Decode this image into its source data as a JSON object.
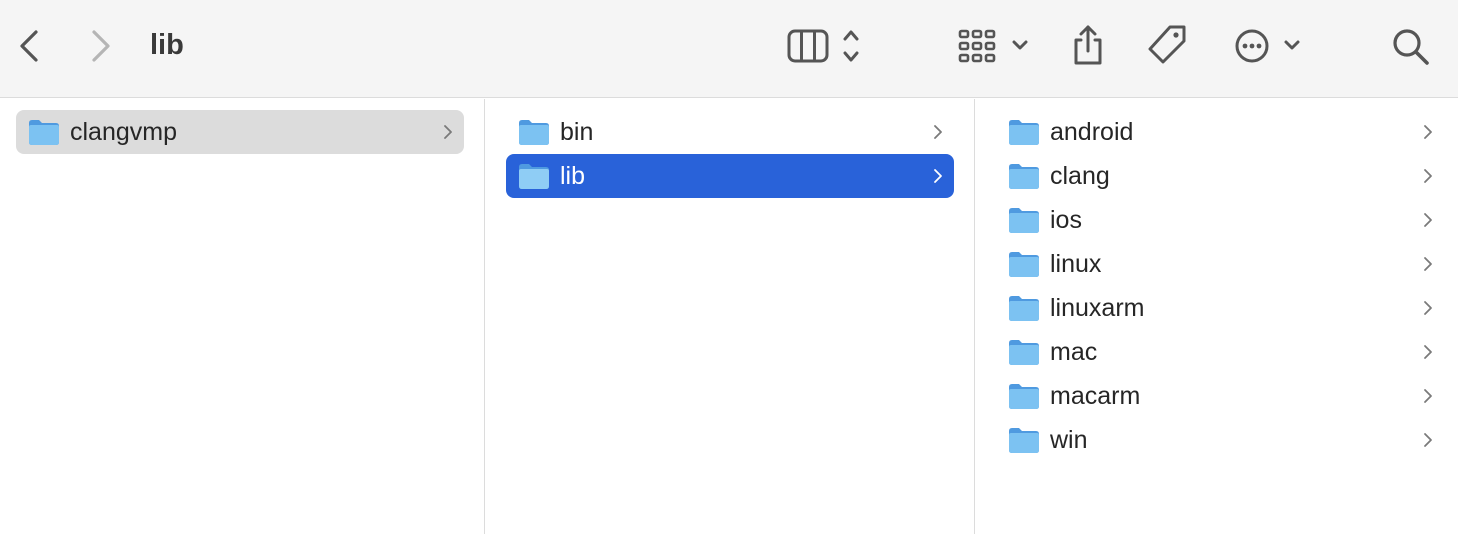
{
  "window": {
    "title": "lib"
  },
  "toolbar": {
    "back_icon": "chevron-left-icon",
    "forward_icon": "chevron-right-icon",
    "view_icon": "column-view-icon",
    "group_icon": "group-grid-icon",
    "share_icon": "share-icon",
    "tag_icon": "tag-icon",
    "more_icon": "ellipsis-circle-icon",
    "search_icon": "search-icon"
  },
  "colors": {
    "selection_blue": "#2962d9",
    "selection_gray": "#dcdcdc",
    "folder_blue": "#6cb6ec",
    "toolbar_bg": "#f5f5f5"
  },
  "columns": [
    {
      "items": [
        {
          "label": "clangvmp",
          "state": "selected-inactive"
        }
      ]
    },
    {
      "items": [
        {
          "label": "bin",
          "state": "normal"
        },
        {
          "label": "lib",
          "state": "selected-active"
        }
      ]
    },
    {
      "items": [
        {
          "label": "android",
          "state": "normal"
        },
        {
          "label": "clang",
          "state": "normal"
        },
        {
          "label": "ios",
          "state": "normal"
        },
        {
          "label": "linux",
          "state": "normal"
        },
        {
          "label": "linuxarm",
          "state": "normal"
        },
        {
          "label": "mac",
          "state": "normal"
        },
        {
          "label": "macarm",
          "state": "normal"
        },
        {
          "label": "win",
          "state": "normal"
        }
      ]
    }
  ]
}
